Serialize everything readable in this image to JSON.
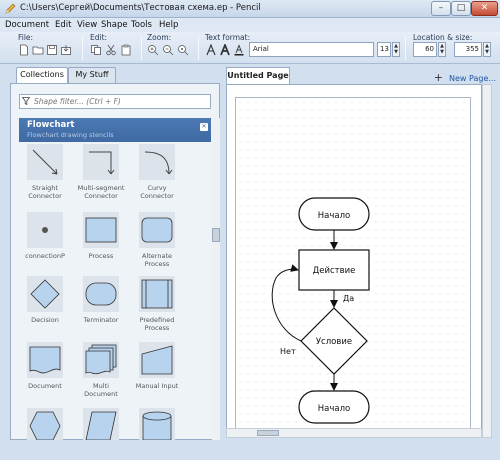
{
  "window": {
    "title": "C:\\Users\\Сергей\\Documents\\Тестовая схема.ep - Pencil",
    "controls": {
      "minimize": "–",
      "maximize": "□",
      "close": "✕"
    }
  },
  "menu": {
    "items": [
      "Document",
      "Edit",
      "View",
      "Shape",
      "Tools",
      "Help"
    ]
  },
  "toolbar": {
    "file_label": "File:",
    "edit_label": "Edit:",
    "zoom_label": "Zoom:",
    "text_format_label": "Text format:",
    "location_size_label": "Location & size:",
    "font_value": "Arial",
    "font_size": "13",
    "location_x": "60",
    "location_y": "355",
    "icons": {
      "file": [
        "new-document-icon",
        "open-folder-icon",
        "save-icon",
        "export-icon"
      ],
      "edit": [
        "copy-icon",
        "cut-icon",
        "paste-icon"
      ],
      "zoom": [
        "zoom-in-icon",
        "zoom-out-icon",
        "zoom-reset-icon"
      ],
      "text": [
        "font-a-icon",
        "font-a-bold-icon",
        "text-color-icon"
      ]
    }
  },
  "left_panel": {
    "tabs": [
      "Collections",
      "My Stuff"
    ],
    "active_tab": "Collections",
    "filter_placeholder": "Shape filter... (Ctrl + F)",
    "stencil": {
      "title": "Flowchart",
      "subtitle": "Flowchart drawing stencils"
    },
    "shapes": [
      {
        "label": "Straight Connector",
        "icon": "straight-connector-icon"
      },
      {
        "label": "Multi-segment Connector",
        "icon": "multi-segment-connector-icon"
      },
      {
        "label": "Curvy Connector",
        "icon": "curvy-connector-icon"
      },
      {
        "label": "connectionP",
        "icon": "connection-point-icon"
      },
      {
        "label": "Process",
        "icon": "process-icon"
      },
      {
        "label": "Alternate Process",
        "icon": "alternate-process-icon"
      },
      {
        "label": "Decision",
        "icon": "decision-icon"
      },
      {
        "label": "Terminator",
        "icon": "terminator-icon"
      },
      {
        "label": "Predefined Process",
        "icon": "predefined-process-icon"
      },
      {
        "label": "Document",
        "icon": "document-icon"
      },
      {
        "label": "Multi Document",
        "icon": "multi-document-icon"
      },
      {
        "label": "Manual Input",
        "icon": "manual-input-icon"
      },
      {
        "label": "",
        "icon": "preparation-icon"
      },
      {
        "label": "",
        "icon": "data-icon"
      },
      {
        "label": "",
        "icon": "database-icon"
      }
    ]
  },
  "document": {
    "tab": "Untitled Page",
    "new_page": "New Page...",
    "flowchart": {
      "start": "Начало",
      "action": "Действие",
      "condition": "Условие",
      "yes": "Да",
      "no": "Нет",
      "end": "Начало"
    }
  },
  "colors": {
    "stencil_header": "#3f6aa3",
    "shape_fill": "#b7d3ee",
    "link": "#1f56a6"
  }
}
